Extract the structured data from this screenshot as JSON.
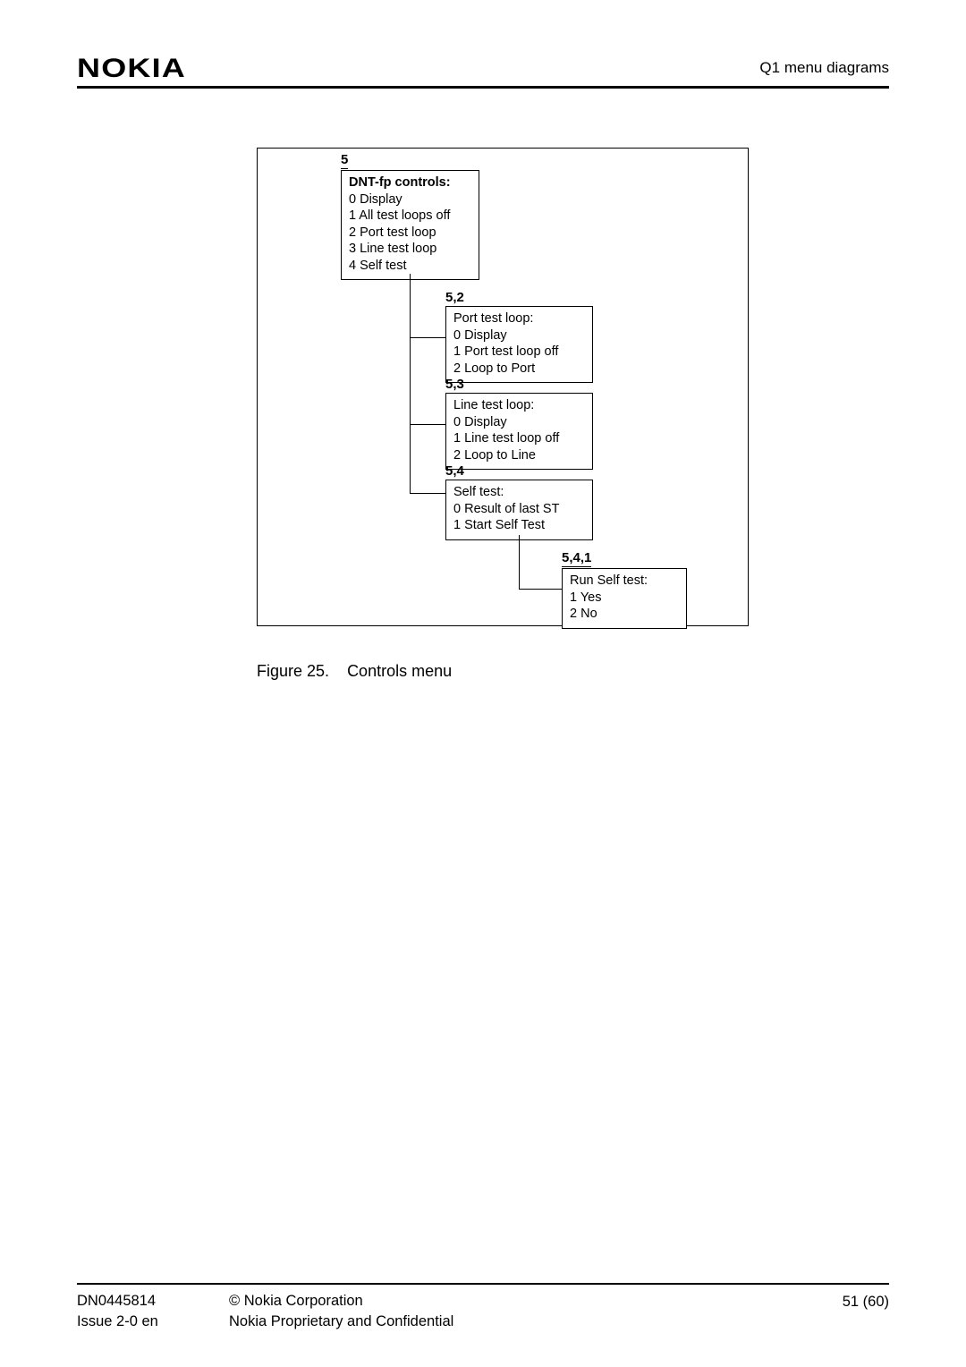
{
  "header": {
    "logo": "NOKIA",
    "right_text": "Q1 menu diagrams"
  },
  "diagram": {
    "box5": {
      "num": "5",
      "title": "DNT-fp controls:",
      "items": [
        "0 Display",
        "1 All test loops off",
        "2 Port test loop",
        "3 Line test loop",
        "4 Self test"
      ]
    },
    "box52": {
      "num": "5,2",
      "title": "Port test loop:",
      "items": [
        "0 Display",
        "1 Port test loop off",
        "2 Loop to Port"
      ]
    },
    "box53": {
      "num": "5,3",
      "title": "Line test loop:",
      "items": [
        "0 Display",
        "1 Line test loop off",
        "2 Loop to Line"
      ]
    },
    "box54": {
      "num": "5,4",
      "title": "Self test:",
      "items": [
        "0 Result of last ST",
        "1 Start Self Test"
      ]
    },
    "box541": {
      "num": "5,4,1",
      "title": "Run Self test:",
      "items": [
        "1 Yes",
        "2 No"
      ]
    }
  },
  "figure": {
    "label": "Figure 25.",
    "title": "Controls menu"
  },
  "footer": {
    "doc_id": "DN0445814",
    "issue": "Issue 2-0 en",
    "copyright": "© Nokia Corporation",
    "confidential": "Nokia Proprietary and Confidential",
    "page": "51 (60)"
  }
}
